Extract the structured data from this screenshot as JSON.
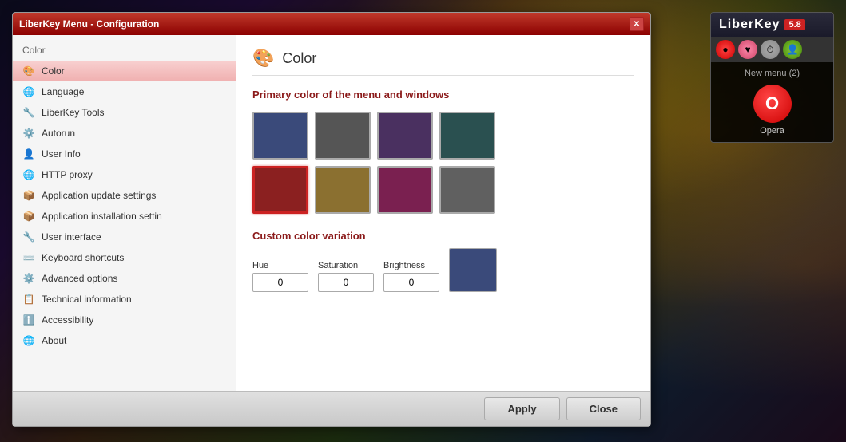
{
  "app": {
    "title": "LiberKey Menu - Configuration",
    "close_btn": "✕"
  },
  "sidebar": {
    "section_label": "Color",
    "items": [
      {
        "id": "color",
        "label": "Color",
        "icon": "🎨",
        "active": true
      },
      {
        "id": "language",
        "label": "Language",
        "icon": "🌐"
      },
      {
        "id": "liberkey-tools",
        "label": "LiberKey Tools",
        "icon": "🔧"
      },
      {
        "id": "autorun",
        "label": "Autorun",
        "icon": "⚙️"
      },
      {
        "id": "user-info",
        "label": "User Info",
        "icon": "👤"
      },
      {
        "id": "http-proxy",
        "label": "HTTP proxy",
        "icon": "🌐"
      },
      {
        "id": "app-update",
        "label": "Application update settings",
        "icon": "📦"
      },
      {
        "id": "app-install",
        "label": "Application installation settin",
        "icon": "📦"
      },
      {
        "id": "user-interface",
        "label": "User interface",
        "icon": "🔧"
      },
      {
        "id": "keyboard-shortcuts",
        "label": "Keyboard shortcuts",
        "icon": "⌨️"
      },
      {
        "id": "advanced-options",
        "label": "Advanced options",
        "icon": "⚙️"
      },
      {
        "id": "technical-info",
        "label": "Technical information",
        "icon": "📋"
      },
      {
        "id": "accessibility",
        "label": "Accessibility",
        "icon": "ℹ️"
      },
      {
        "id": "about",
        "label": "About",
        "icon": "🌐"
      }
    ]
  },
  "main": {
    "section_icon": "🎨",
    "section_title": "Color",
    "primary_color_label": "Primary color of the menu and windows",
    "swatches": [
      {
        "color": "#3a4a7a",
        "selected": false
      },
      {
        "color": "#555555",
        "selected": false
      },
      {
        "color": "#4a3060",
        "selected": false
      },
      {
        "color": "#2a5050",
        "selected": false
      },
      {
        "color": "#8b2020",
        "selected": true
      },
      {
        "color": "#8b7030",
        "selected": false
      },
      {
        "color": "#7a2050",
        "selected": false
      },
      {
        "color": "#606060",
        "selected": false
      }
    ],
    "custom_color_title": "Custom color variation",
    "hue_label": "Hue",
    "hue_value": "0",
    "saturation_label": "Saturation",
    "saturation_value": "0",
    "brightness_label": "Brightness",
    "brightness_value": "0",
    "preview_color": "#3a4a7a"
  },
  "footer": {
    "apply_label": "Apply",
    "close_label": "Close"
  },
  "liberkey": {
    "logo": "LiberKey",
    "version": "5.8",
    "menu_label": "New menu (2)",
    "opera_label": "Opera"
  }
}
